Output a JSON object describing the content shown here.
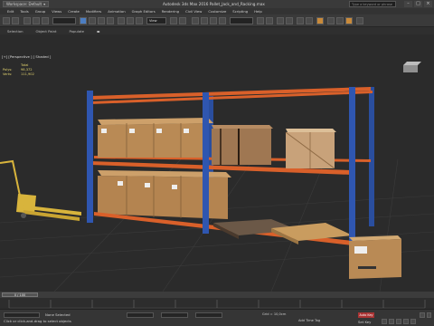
{
  "titlebar": {
    "workspace": "Workspace: Default",
    "title": "Autodesk 3ds Max 2016    Pallet_Jack_and_Racking.max",
    "search_placeholder": "Type a keyword or phrase"
  },
  "menu": [
    "Edit",
    "Tools",
    "Group",
    "Views",
    "Create",
    "Modifiers",
    "Animation",
    "Graph Editors",
    "Rendering",
    "Civil View",
    "Customize",
    "Scripting",
    "Help"
  ],
  "toolbar": {
    "view_dropdown": "View"
  },
  "ribbon": [
    "Selection",
    "Object Paint",
    "Populate"
  ],
  "viewport": {
    "label": "[+] [Perspective ] [ Shaded ]",
    "stats": [
      {
        "label": "",
        "value": "Total"
      },
      {
        "label": "Polys:",
        "value": "98,372"
      },
      {
        "label": "Verts:",
        "value": "111,902"
      }
    ]
  },
  "timeline": {
    "position": "0 / 100"
  },
  "status": {
    "selection": "None Selected",
    "hint": "Click or click-and-drag to select objects",
    "grid": "Grid = 10,0cm",
    "add_time_tag": "Add Time Tag",
    "auto_key": "Auto Key",
    "set_key": "Set Key"
  },
  "colors": {
    "rack_beam": "#d9602a",
    "rack_upright": "#2f56b0",
    "cardboard": "#b98a55",
    "wood_crate": "#c8a27a",
    "pallet_jack": "#d8b43c"
  }
}
